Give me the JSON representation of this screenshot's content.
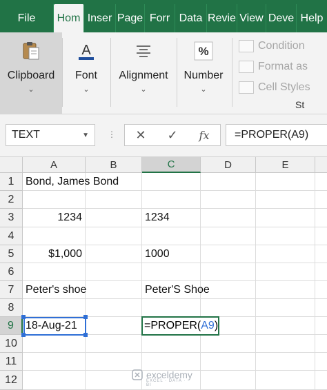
{
  "tabs": [
    {
      "label": "File",
      "active": false
    },
    {
      "label": "Hom",
      "active": true
    },
    {
      "label": "Inser",
      "active": false
    },
    {
      "label": "Page",
      "active": false
    },
    {
      "label": "Forr",
      "active": false
    },
    {
      "label": "Data",
      "active": false
    },
    {
      "label": "Revie",
      "active": false
    },
    {
      "label": "View",
      "active": false
    },
    {
      "label": "Deve",
      "active": false
    },
    {
      "label": "Help",
      "active": false
    }
  ],
  "ribbon": {
    "clipboard": "Clipboard",
    "font": "Font",
    "alignment": "Alignment",
    "number": "Number",
    "number_icon": "%",
    "font_icon": "A",
    "styles": [
      "Condition",
      "Format as",
      "Cell Styles"
    ],
    "styles_group_label": "St"
  },
  "formula_bar": {
    "name_box": "TEXT",
    "formula": "=PROPER(A9)"
  },
  "columns": [
    "A",
    "B",
    "C",
    "D",
    "E"
  ],
  "rows": [
    "1",
    "2",
    "3",
    "4",
    "5",
    "6",
    "7",
    "8",
    "9",
    "10",
    "11",
    "12"
  ],
  "cells": {
    "A1": "Bond, James Bond",
    "A3": "1234",
    "C3": "1234",
    "A5": "$1,000",
    "C5": "1000",
    "A7": "Peter's shoe",
    "C7": "Peter'S Shoe",
    "A9": "18-Aug-21"
  },
  "edit": {
    "prefix": "=PROPER(",
    "ref": "A9",
    "suffix": ")"
  },
  "watermark": {
    "name": "exceldemy",
    "tagline": "EXCEL · DATA · BI"
  },
  "colors": {
    "excel_green": "#217346",
    "ref_blue": "#2f6fd6"
  }
}
